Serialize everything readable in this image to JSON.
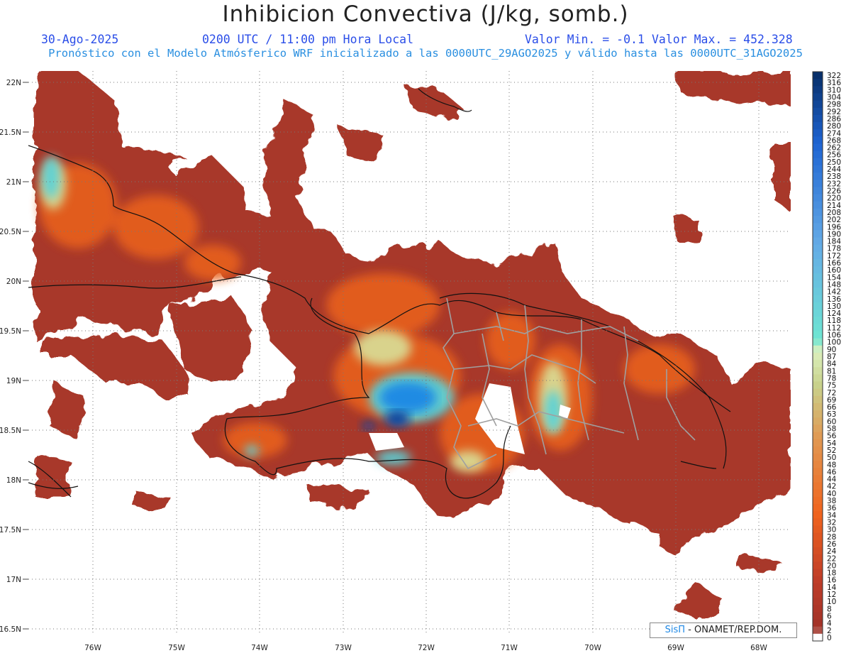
{
  "header": {
    "title": "Inhibicion Convectiva (J/kg, somb.)",
    "date": "30-Ago-2025",
    "time": "0200 UTC / 11:00 pm Hora Local",
    "min_label": "Valor Min. = -0.1",
    "max_label": "Valor Max. = 452.328",
    "subtitle": "Pronóstico con el Modelo Atmósferico WRF inicializado a las 0000UTC_29AGO2025 y válido hasta las  0000UTC_31AGO2025"
  },
  "map": {
    "lat_labels": [
      "22N",
      "21.5N",
      "21N",
      "20.5N",
      "20N",
      "19.5N",
      "19N",
      "18.5N",
      "18N",
      "17.5N",
      "17N",
      "16.5N"
    ],
    "lon_labels": [
      "76W",
      "75W",
      "74W",
      "73W",
      "72W",
      "71W",
      "70W",
      "69W",
      "68W"
    ],
    "grid": "dotted"
  },
  "colorbar": {
    "ticks": [
      "322",
      "316",
      "310",
      "304",
      "298",
      "292",
      "286",
      "280",
      "274",
      "268",
      "262",
      "256",
      "250",
      "244",
      "238",
      "232",
      "226",
      "220",
      "214",
      "208",
      "202",
      "196",
      "190",
      "184",
      "178",
      "172",
      "166",
      "160",
      "154",
      "148",
      "142",
      "136",
      "130",
      "124",
      "118",
      "112",
      "106",
      "100",
      "90",
      "87",
      "84",
      "81",
      "78",
      "75",
      "72",
      "69",
      "66",
      "63",
      "60",
      "58",
      "56",
      "54",
      "52",
      "50",
      "48",
      "46",
      "44",
      "42",
      "40",
      "38",
      "36",
      "34",
      "32",
      "30",
      "28",
      "26",
      "24",
      "22",
      "20",
      "18",
      "16",
      "14",
      "12",
      "10",
      "8",
      "6",
      "4",
      "2",
      "0"
    ]
  },
  "credit": {
    "sis": "SisΠ",
    "rest": " - ONAMET/REP.DOM."
  },
  "colors": {
    "land_field": "#a8392a",
    "orange": "#e8601c",
    "cyan": "#5ad2d8",
    "blue": "#1565c0",
    "title_blue": "#2b4ee8",
    "subtitle_blue": "#2a8fe0"
  }
}
